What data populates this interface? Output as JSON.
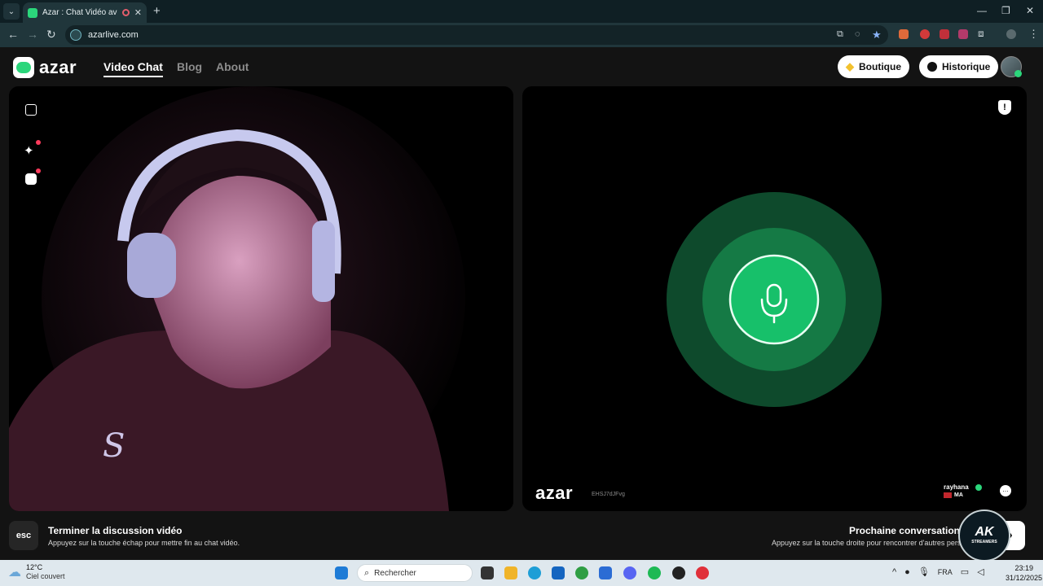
{
  "browser": {
    "tab_title": "Azar : Chat Vidéo avec de n",
    "url": "azarlive.com"
  },
  "site": {
    "logo_text": "azar",
    "nav": [
      {
        "label": "Video Chat",
        "active": true
      },
      {
        "label": "Blog"
      },
      {
        "label": "About"
      }
    ],
    "boutique_label": "Boutique",
    "historique_label": "Historique"
  },
  "remote": {
    "watermark": "azar",
    "id_code": "EHSJ7dJFvg",
    "username": "rayhana",
    "country": "MA"
  },
  "footer": {
    "esc_key": "esc",
    "end_title": "Terminer la discussion vidéo",
    "end_subtitle": "Appuyez sur la touche échap pour mettre fin au chat vidéo.",
    "next_title": "Prochaine conversation",
    "next_subtitle": "Appuyez sur la touche droite pour rencontrer d'autres personnes.",
    "overlay_logo_line1": "AK",
    "overlay_logo_line2": "STREAMERS"
  },
  "taskbar": {
    "temperature": "12°C",
    "weather": "Ciel couvert",
    "search_placeholder": "Rechercher",
    "language": "FRA",
    "time": "23:19",
    "date": "31/12/2025"
  },
  "colors": {
    "accent_green": "#2bd67b",
    "ring_outer": "#0e4a2c",
    "ring_middle": "#157a45",
    "mic_button": "#17c06a"
  },
  "icons": [
    "new-tab-icon",
    "back-icon",
    "forward-icon",
    "reload-icon",
    "star-icon",
    "extensions-icon",
    "menu-icon",
    "collapse-icon",
    "sparkle-icon",
    "face-icon",
    "report-shield-icon",
    "mic-icon",
    "chat-icon",
    "diamond-icon",
    "clock-icon",
    "next-arrow-icon",
    "search-icon",
    "weather-icon"
  ]
}
